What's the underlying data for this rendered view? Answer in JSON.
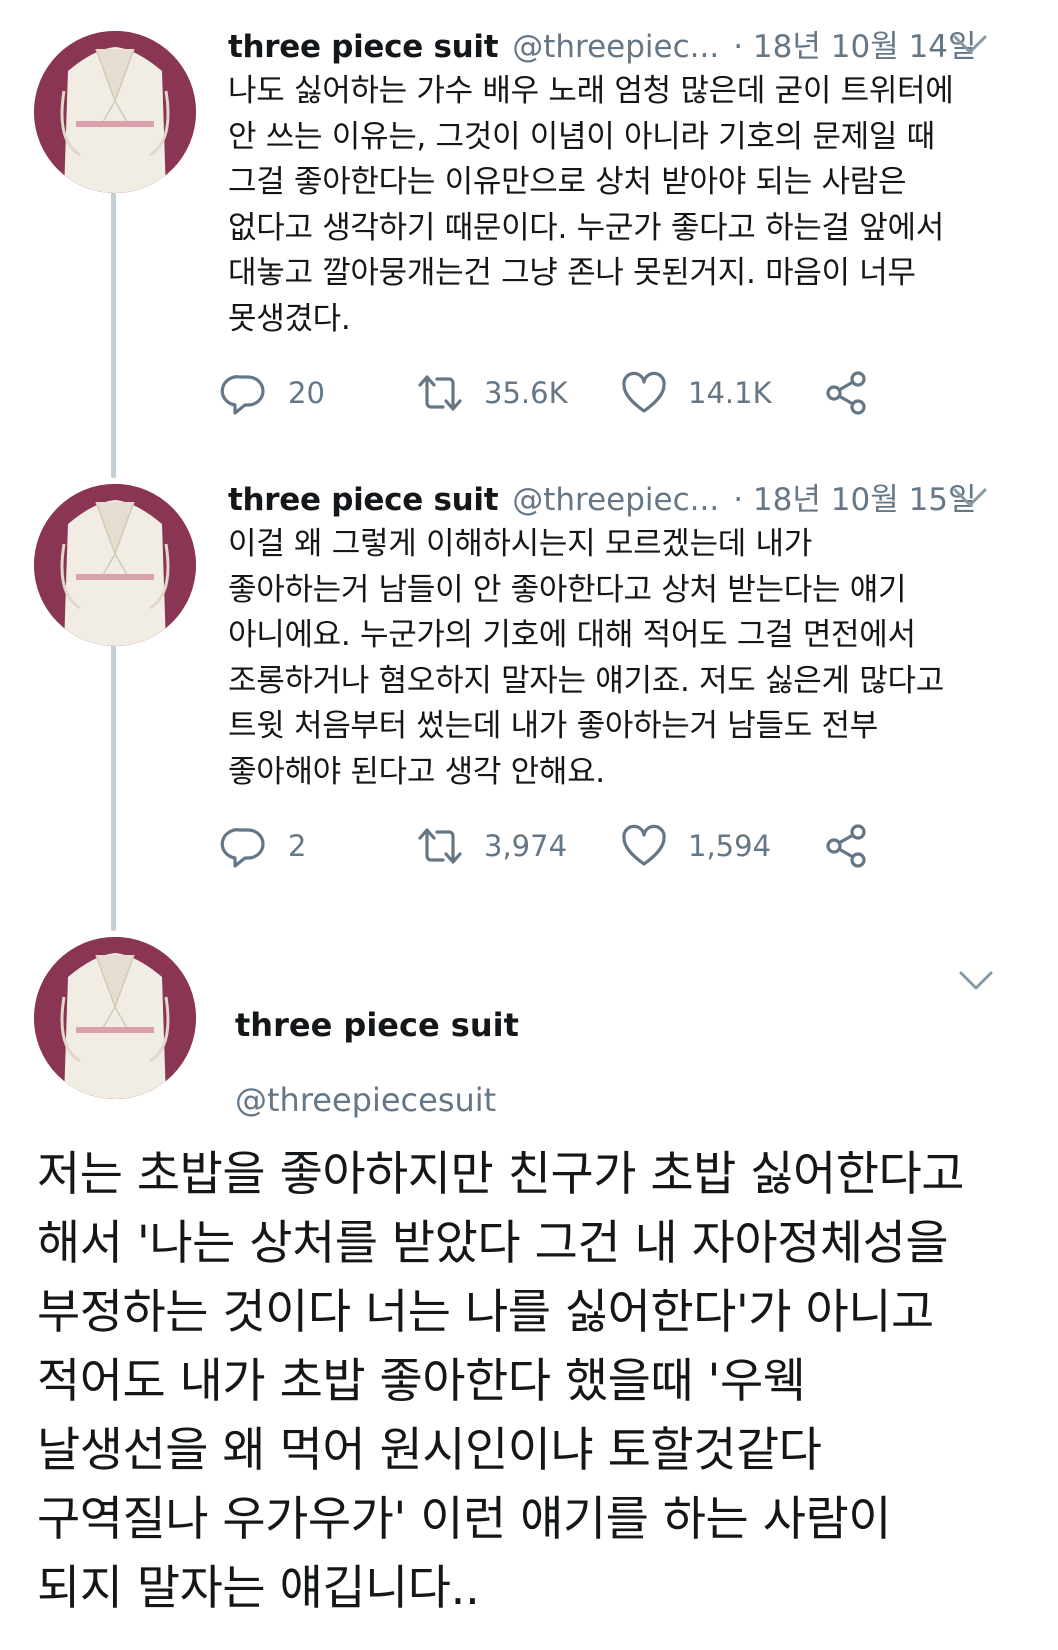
{
  "tweets": [
    {
      "author_name": "three piece suit",
      "author_handle": "@threepiec...",
      "date": "· 18년 10월 14일",
      "text_lines": [
        "나도 싫어하는 가수 배우 노래 엄청 많은데 굳이 트위터에",
        "안 쓰는 이유는, 그것이 이념이 아니라 기호의 문제일 때",
        "그걸 좋아한다는 이유만으로 상처 받아야 되는 사람은",
        "없다고 생각하기 때문이다. 누군가 좋다고 하는걸 앞에서",
        "대놓고 깔아뭉개는건 그냥 존나 못된거지. 마음이 너무",
        "못생겼다."
      ],
      "replies": "20",
      "retweets": "35.6K",
      "likes": "14.1K"
    },
    {
      "author_name": "three piece suit",
      "author_handle": "@threepiec...",
      "date": "· 18년 10월 15일",
      "text_lines": [
        "이걸 왜 그렇게 이해하시는지 모르겠는데 내가",
        "좋아하는거 남들이 안 좋아한다고 상처 받는다는 얘기",
        "아니에요. 누군가의 기호에 대해 적어도 그걸 면전에서",
        "조롱하거나 혐오하지 말자는 얘기죠. 저도 싫은게 많다고",
        "트윗 처음부터 썼는데 내가 좋아하는거 남들도 전부",
        "좋아해야 된다고 생각 안해요."
      ],
      "replies": "2",
      "retweets": "3,974",
      "likes": "1,594"
    }
  ],
  "expanded_tweet": {
    "author_name": "three piece suit",
    "author_handle": "@threepiecesuit",
    "text_lines": [
      "저는 초밥을 좋아하지만 친구가 초밥 싫어한다고",
      "해서 '나는 상처를 받았다 그건 내 자아정체성을",
      "부정하는 것이다 너는 나를 싫어한다'가 아니고",
      "적어도 내가 초밥 좋아한다 했을때 '우웩",
      "날생선을 왜 먹어 원시인이냐 토할것같다",
      "구역질나 우가우가' 이런 얘기를 하는 사람이",
      "되지 말자는 얘깁니다.."
    ]
  },
  "icons": [
    "reply-icon",
    "retweet-icon",
    "like-icon",
    "share-icon",
    "chevron-down-icon"
  ],
  "colors": {
    "text": "#14171a",
    "secondary": "#657786",
    "thread_line": "#c4cfd6",
    "avatar_bg": "#8a3554",
    "suit": "#f2ede4"
  }
}
